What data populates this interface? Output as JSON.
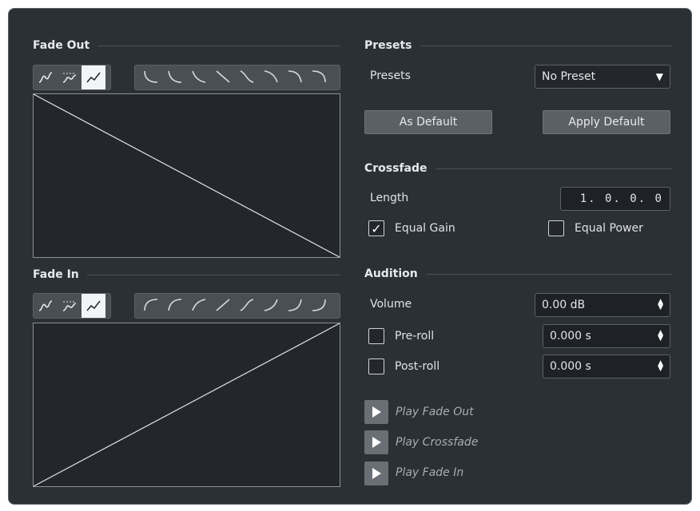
{
  "fade_out": {
    "title": "Fade Out"
  },
  "fade_in": {
    "title": "Fade In"
  },
  "presets": {
    "title": "Presets",
    "label": "Presets",
    "value": "No Preset",
    "as_default": "As Default",
    "apply_default": "Apply Default"
  },
  "crossfade": {
    "title": "Crossfade",
    "length_label": "Length",
    "length_value": "1. 0. 0.  0",
    "equal_gain_label": "Equal Gain",
    "equal_gain_checked": true,
    "equal_power_label": "Equal Power",
    "equal_power_checked": false
  },
  "audition": {
    "title": "Audition",
    "volume_label": "Volume",
    "volume_value": "0.00 dB",
    "preroll_label": "Pre-roll",
    "preroll_value": "0.000 s",
    "postroll_label": "Post-roll",
    "postroll_value": "0.000 s",
    "play_fade_out": "Play Fade Out",
    "play_crossfade": "Play Crossfade",
    "play_fade_in": "Play Fade In"
  },
  "icons": {
    "checkmark": "✓",
    "dropdown": "▼",
    "spin_up": "▲",
    "spin_down": "▼"
  },
  "colors": {
    "background": "#2b3035",
    "graph_bg": "#23272b",
    "active_mode": "#f3f4f5"
  }
}
